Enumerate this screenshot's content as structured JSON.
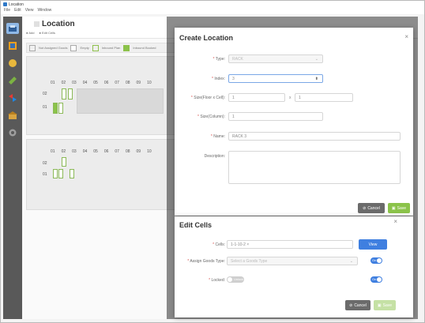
{
  "window": {
    "title": "Location",
    "menu": [
      "File",
      "Edit",
      "View",
      "Window"
    ]
  },
  "sidebar": {
    "icons": [
      "location-icon",
      "grid-icon",
      "box-icon",
      "tag-icon",
      "swap-icon",
      "warehouse-icon",
      "gear-icon"
    ]
  },
  "page": {
    "title": "Location",
    "actions": [
      "Add",
      "Edit Cells"
    ],
    "legend": [
      "Not Assigned Goods",
      "Empty",
      "Inbound Plan",
      "Inbound Booked"
    ]
  },
  "rack1": {
    "columns": [
      "01",
      "02",
      "03",
      "04",
      "05",
      "06",
      "07",
      "08",
      "09",
      "10"
    ],
    "rows": [
      "02",
      "01"
    ]
  },
  "rack2": {
    "columns": [
      "01",
      "02",
      "03",
      "04",
      "05",
      "06",
      "07",
      "08",
      "09",
      "10"
    ],
    "rows": [
      "02",
      "01"
    ]
  },
  "create_dialog": {
    "title": "Create Location",
    "close": "×",
    "type_label": "Type:",
    "type_value": "RACK",
    "index_label": "Index:",
    "index_value": "3",
    "size_floor_label": "Size(Floor x Cell):",
    "size_floor_a": "1",
    "size_times": "x",
    "size_floor_b": "1",
    "size_column_label": "Size(Column):",
    "size_column_value": "1",
    "name_label": "Name:",
    "name_value": "RACK 3",
    "description_label": "Description:",
    "description_value": "",
    "cancel": "Cancel",
    "save": "Save"
  },
  "edit_dialog": {
    "title": "Edit Cells",
    "close": "×",
    "cells_label": "Cells:",
    "cells_value": "1-1-10-2 ×",
    "view_button": "View",
    "assign_label": "Assign Goods Type:",
    "assign_placeholder": "Select a Goods Type",
    "assign_toggle": "On",
    "locked_label": "Locked:",
    "locked_toggle": "Unlock",
    "locked_right_toggle": "On",
    "cancel": "Cancel",
    "save": "Save"
  },
  "colors": {
    "primary": "#3f7fe0",
    "success": "#8bc34a",
    "cancel": "#6b6b6b",
    "sidebar": "#595959"
  }
}
